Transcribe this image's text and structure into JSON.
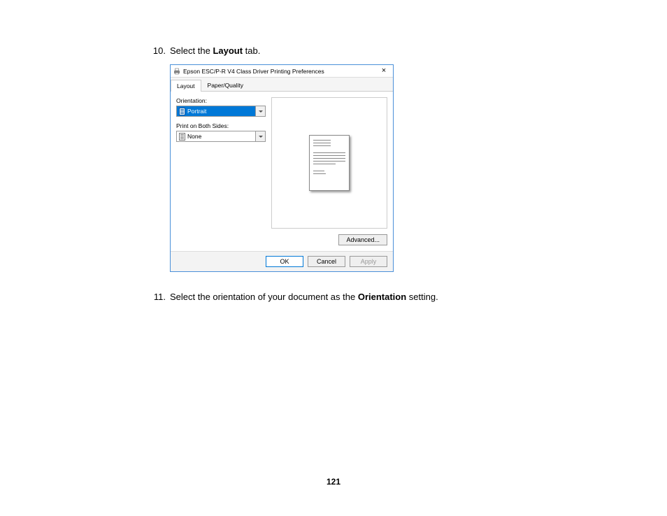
{
  "page_number": "121",
  "steps": {
    "s10": {
      "num": "10.",
      "before": "Select the ",
      "bold": "Layout",
      "after": " tab."
    },
    "s11": {
      "num": "11.",
      "before": "Select the orientation of your document as the ",
      "bold": "Orientation",
      "after": " setting."
    }
  },
  "dialog": {
    "title": "Epson ESC/P-R V4 Class Driver Printing Preferences",
    "close": "×",
    "tabs": {
      "layout": "Layout",
      "paper": "Paper/Quality"
    },
    "labels": {
      "orientation": "Orientation:",
      "both_sides": "Print on Both Sides:"
    },
    "values": {
      "orientation": "Portrait",
      "both_sides": "None"
    },
    "buttons": {
      "advanced": "Advanced...",
      "ok": "OK",
      "cancel": "Cancel",
      "apply": "Apply"
    }
  }
}
